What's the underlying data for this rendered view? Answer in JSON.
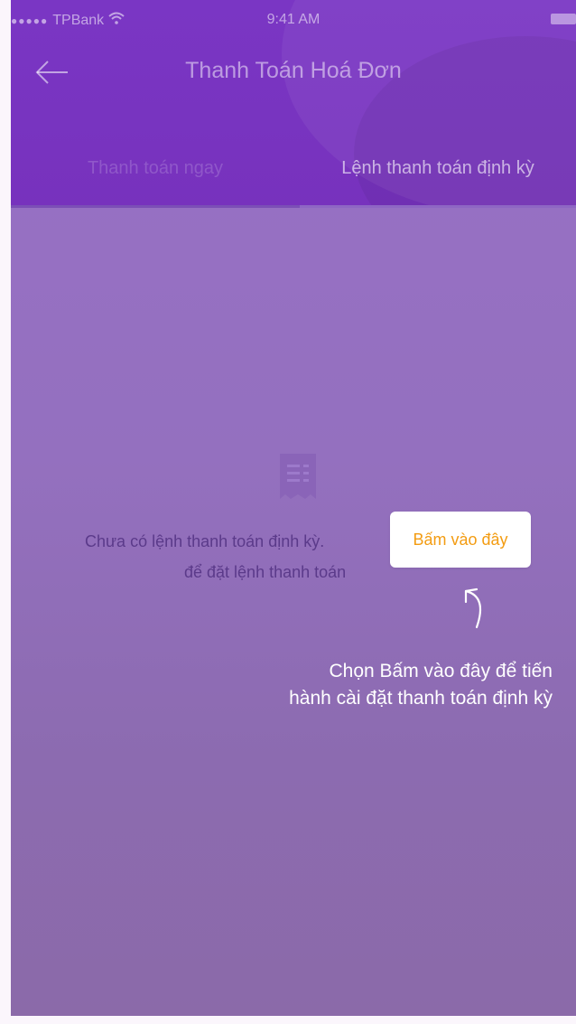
{
  "statusbar": {
    "carrier": "TPBank",
    "time": "9:41 AM"
  },
  "navbar": {
    "title": "Thanh Toán Hoá Đơn"
  },
  "tabs": [
    {
      "label": "Thanh toán ngay",
      "selected": false
    },
    {
      "label": "Lệnh thanh toán định kỳ",
      "selected": true
    }
  ],
  "empty_state": {
    "line1": "Chưa có lệnh thanh toán định kỳ.",
    "line2": "để đặt lệnh thanh toán",
    "action_label": "Bấm vào đây"
  },
  "hint": {
    "text": "Chọn Bấm vào đây để tiến hành cài đặt thanh toán định kỳ"
  },
  "colors": {
    "header": "#7a36c4",
    "body": "#9870c6",
    "action_text": "#f39c12",
    "empty_text": "#5b3a8a"
  },
  "icons": [
    "wifi-icon",
    "battery-icon",
    "back-arrow-icon",
    "receipt-icon",
    "curved-arrow-icon"
  ]
}
